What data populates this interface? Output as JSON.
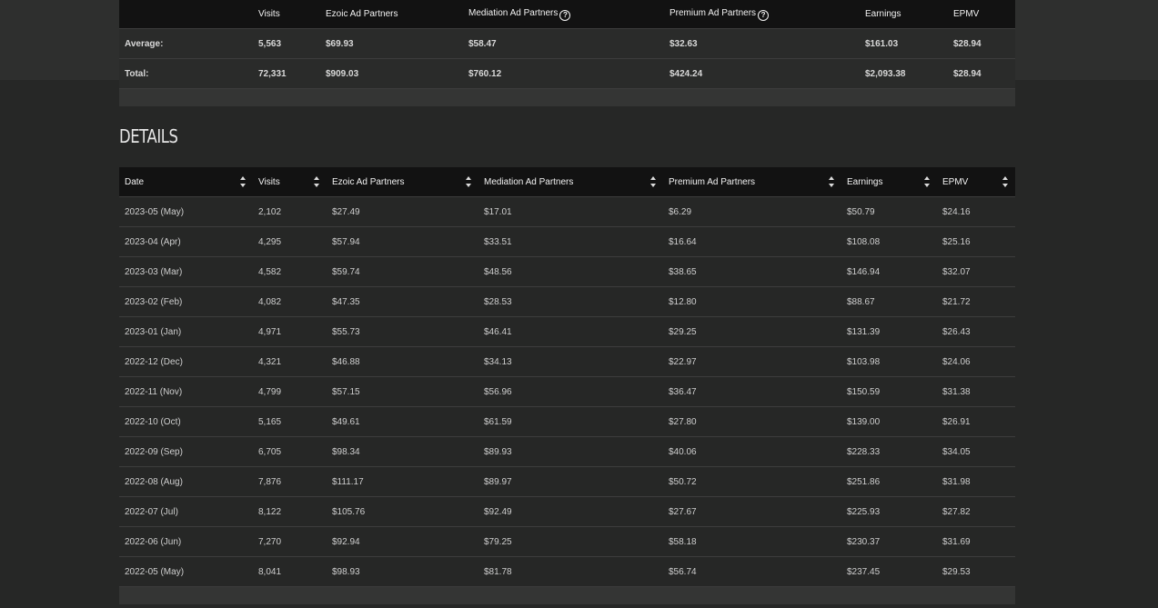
{
  "summary": {
    "headers": [
      "",
      "Visits",
      "Ezoic Ad Partners",
      "Mediation Ad Partners",
      "Premium Ad Partners",
      "Earnings",
      "EPMV"
    ],
    "rows": [
      [
        "Average:",
        "5,563",
        "$69.93",
        "$58.47",
        "$32.63",
        "$161.03",
        "$28.94"
      ],
      [
        "Total:",
        "72,331",
        "$909.03",
        "$760.12",
        "$424.24",
        "$2,093.38",
        "$28.94"
      ]
    ]
  },
  "details": {
    "title": "DETAILS",
    "headers": [
      "Date",
      "Visits",
      "Ezoic Ad Partners",
      "Mediation Ad Partners",
      "Premium Ad Partners",
      "Earnings",
      "EPMV"
    ],
    "rows": [
      [
        "2023-05 (May)",
        "2,102",
        "$27.49",
        "$17.01",
        "$6.29",
        "$50.79",
        "$24.16"
      ],
      [
        "2023-04 (Apr)",
        "4,295",
        "$57.94",
        "$33.51",
        "$16.64",
        "$108.08",
        "$25.16"
      ],
      [
        "2023-03 (Mar)",
        "4,582",
        "$59.74",
        "$48.56",
        "$38.65",
        "$146.94",
        "$32.07"
      ],
      [
        "2023-02 (Feb)",
        "4,082",
        "$47.35",
        "$28.53",
        "$12.80",
        "$88.67",
        "$21.72"
      ],
      [
        "2023-01 (Jan)",
        "4,971",
        "$55.73",
        "$46.41",
        "$29.25",
        "$131.39",
        "$26.43"
      ],
      [
        "2022-12 (Dec)",
        "4,321",
        "$46.88",
        "$34.13",
        "$22.97",
        "$103.98",
        "$24.06"
      ],
      [
        "2022-11 (Nov)",
        "4,799",
        "$57.15",
        "$56.96",
        "$36.47",
        "$150.59",
        "$31.38"
      ],
      [
        "2022-10 (Oct)",
        "5,165",
        "$49.61",
        "$61.59",
        "$27.80",
        "$139.00",
        "$26.91"
      ],
      [
        "2022-09 (Sep)",
        "6,705",
        "$98.34",
        "$89.93",
        "$40.06",
        "$228.33",
        "$34.05"
      ],
      [
        "2022-08 (Aug)",
        "7,876",
        "$111.17",
        "$89.97",
        "$50.72",
        "$251.86",
        "$31.98"
      ],
      [
        "2022-07 (Jul)",
        "8,122",
        "$105.76",
        "$92.49",
        "$27.67",
        "$225.93",
        "$27.82"
      ],
      [
        "2022-06 (Jun)",
        "7,270",
        "$92.94",
        "$79.25",
        "$58.18",
        "$230.37",
        "$31.69"
      ],
      [
        "2022-05 (May)",
        "8,041",
        "$98.93",
        "$81.78",
        "$56.74",
        "$237.45",
        "$29.53"
      ]
    ]
  },
  "icons": {
    "help": "question-circle-icon",
    "sort": "sort-arrows-icon"
  },
  "colors": {
    "background": "#262726",
    "header": "#121212",
    "text": "#d6d6d6"
  }
}
